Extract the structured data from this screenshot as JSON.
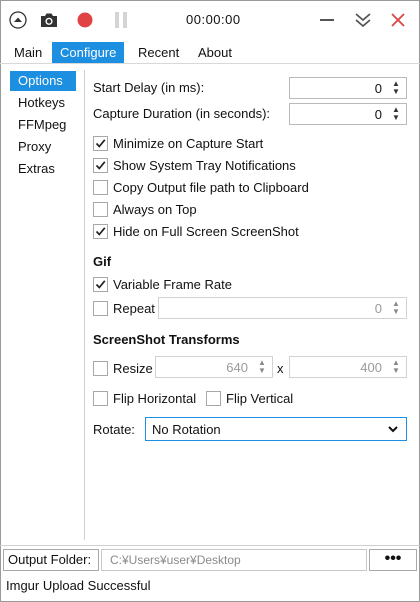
{
  "titlebar": {
    "timer": "00:00:00",
    "record_color": "#e04343",
    "accent_color": "#1d8fe0"
  },
  "tabs": [
    {
      "label": "Main",
      "active": false
    },
    {
      "label": "Configure",
      "active": true
    },
    {
      "label": "Recent",
      "active": false
    },
    {
      "label": "About",
      "active": false
    }
  ],
  "sidebar": {
    "items": [
      {
        "label": "Options",
        "active": true
      },
      {
        "label": "Hotkeys",
        "active": false
      },
      {
        "label": "FFMpeg",
        "active": false
      },
      {
        "label": "Proxy",
        "active": false
      },
      {
        "label": "Extras",
        "active": false
      }
    ]
  },
  "options": {
    "start_delay_label": "Start Delay (in ms):",
    "start_delay_value": "0",
    "capture_duration_label": "Capture Duration (in seconds):",
    "capture_duration_value": "0",
    "checkboxes": [
      {
        "label": "Minimize on Capture Start",
        "checked": true
      },
      {
        "label": "Show System Tray Notifications",
        "checked": true
      },
      {
        "label": "Copy Output file path to Clipboard",
        "checked": false
      },
      {
        "label": "Always on Top",
        "checked": false
      },
      {
        "label": "Hide on Full Screen ScreenShot",
        "checked": true
      }
    ]
  },
  "gif": {
    "heading": "Gif",
    "variable_frame_rate_label": "Variable Frame Rate",
    "variable_frame_rate_checked": true,
    "repeat_label": "Repeat",
    "repeat_checked": false,
    "repeat_value": "0"
  },
  "transforms": {
    "heading": "ScreenShot Transforms",
    "resize_label": "Resize",
    "resize_checked": false,
    "width_value": "640",
    "x_label": "x",
    "height_value": "400",
    "flip_horizontal_label": "Flip Horizontal",
    "flip_vertical_label": "Flip Vertical",
    "rotate_label": "Rotate:",
    "rotate_value": "No Rotation"
  },
  "output": {
    "folder_label": "Output Folder:",
    "folder_path": "C:¥Users¥user¥Desktop",
    "browse_label": "•••"
  },
  "status": {
    "text": "Imgur Upload Successful"
  }
}
